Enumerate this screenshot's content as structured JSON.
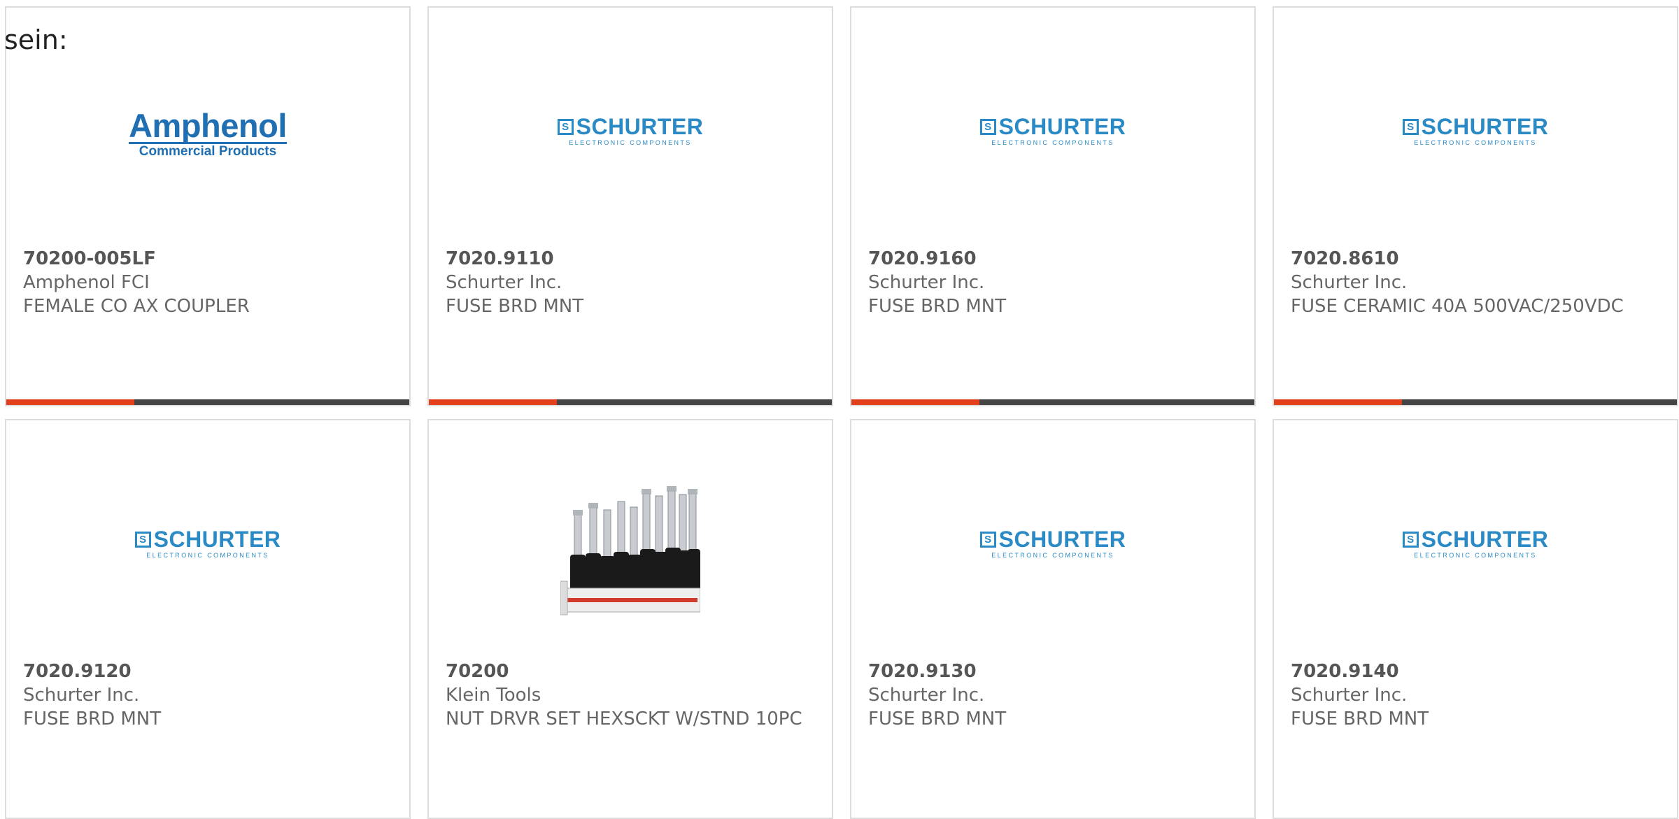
{
  "prefix_text": "sein:",
  "colors": {
    "accent": "#e2401c",
    "bar": "#444444",
    "brand_blue": "#1f6fb2",
    "schurter_blue": "#2a8ac6"
  },
  "cards": [
    {
      "part_number": "70200-005LF",
      "manufacturer": "Amphenol FCI",
      "description": "FEMALE CO AX COUPLER",
      "logo": "Amphenol",
      "logo_sub": "Commercial Products"
    },
    {
      "part_number": "7020.9110",
      "manufacturer": "Schurter Inc.",
      "description": "FUSE BRD MNT",
      "logo": "SCHURTER",
      "logo_sub": "ELECTRONIC COMPONENTS"
    },
    {
      "part_number": "7020.9160",
      "manufacturer": "Schurter Inc.",
      "description": "FUSE BRD MNT",
      "logo": "SCHURTER",
      "logo_sub": "ELECTRONIC COMPONENTS"
    },
    {
      "part_number": "7020.8610",
      "manufacturer": "Schurter Inc.",
      "description": "FUSE CERAMIC 40A 500VAC/250VDC",
      "logo": "SCHURTER",
      "logo_sub": "ELECTRONIC COMPONENTS"
    },
    {
      "part_number": "7020.9120",
      "manufacturer": "Schurter Inc.",
      "description": "FUSE BRD MNT",
      "logo": "SCHURTER",
      "logo_sub": "ELECTRONIC COMPONENTS"
    },
    {
      "part_number": "70200",
      "manufacturer": "Klein Tools",
      "description": "NUT DRVR SET HEXSCKT W/STND 10PC",
      "logo": "",
      "logo_sub": ""
    },
    {
      "part_number": "7020.9130",
      "manufacturer": "Schurter Inc.",
      "description": "FUSE BRD MNT",
      "logo": "SCHURTER",
      "logo_sub": "ELECTRONIC COMPONENTS"
    },
    {
      "part_number": "7020.9140",
      "manufacturer": "Schurter Inc.",
      "description": "FUSE BRD MNT",
      "logo": "SCHURTER",
      "logo_sub": "ELECTRONIC COMPONENTS"
    }
  ]
}
